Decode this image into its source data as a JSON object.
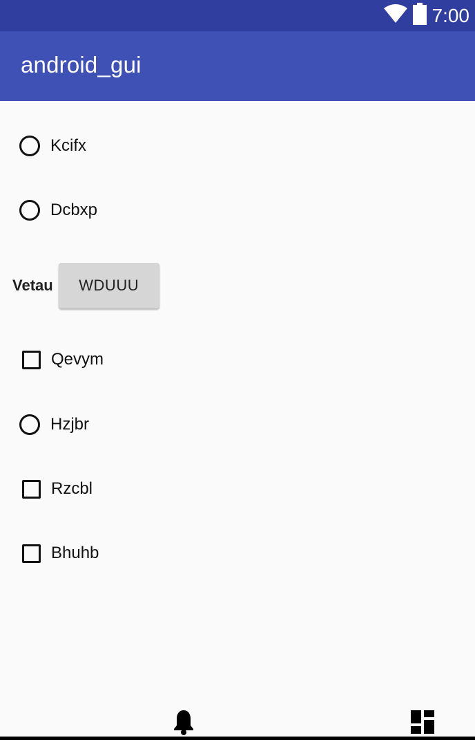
{
  "status_bar": {
    "time": "7:00",
    "wifi_icon": "wifi-icon",
    "battery_icon": "battery-icon"
  },
  "app_bar": {
    "title": "android_gui"
  },
  "controls": {
    "radio_kcifx": {
      "label": "Kcifx",
      "checked": false
    },
    "radio_dcbxp": {
      "label": "Dcbxp",
      "checked": false
    },
    "vetau": {
      "label": "Vetau",
      "button": "WDUUU"
    },
    "check_qevym": {
      "label": "Qevym",
      "checked": false
    },
    "radio_hzjbr": {
      "label": "Hzjbr",
      "checked": false
    },
    "check_rzcbl": {
      "label": "Rzcbl",
      "checked": false
    },
    "check_bhuhb": {
      "label": "Bhuhb",
      "checked": false
    }
  },
  "nav_bar": {
    "icons": [
      "bell-icon",
      "dashboard-icon"
    ]
  },
  "colors": {
    "status_bar": "#303f9f",
    "app_bar": "#3f51b5",
    "background": "#fafafa",
    "button": "#d6d6d6"
  }
}
